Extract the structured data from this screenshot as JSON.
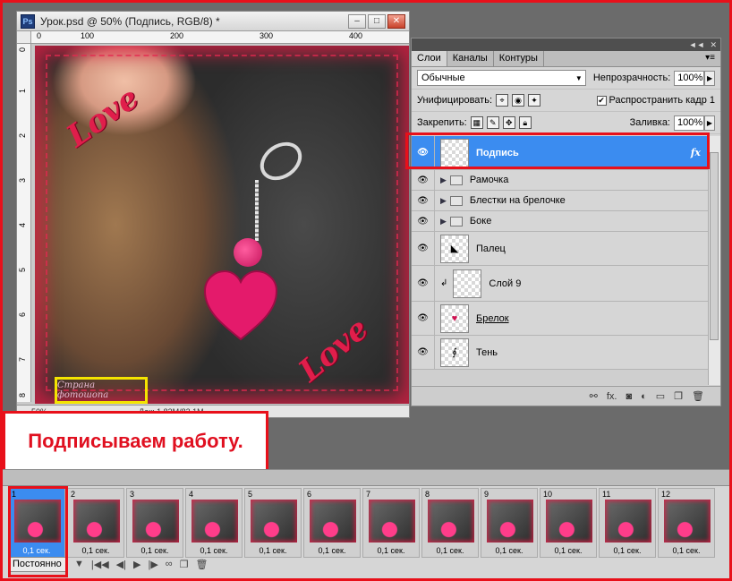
{
  "document": {
    "title": "Урок.psd @ 50% (Подпись, RGB/8) *",
    "zoom": "50%",
    "doc_info": "Док: 1,83M/82,1M",
    "ruler_marks": [
      "0",
      "100",
      "200",
      "300",
      "400"
    ],
    "ruler_v_marks": [
      "0",
      "1",
      "2",
      "3",
      "4",
      "5",
      "6",
      "7",
      "8"
    ],
    "artwork_text_1": "Love",
    "artwork_text_2": "Love",
    "signature": "Страна фотошопа"
  },
  "layers_panel": {
    "tabs": [
      "Слои",
      "Каналы",
      "Контуры"
    ],
    "blend_mode": "Обычные",
    "opacity_label": "Непрозрачность:",
    "opacity_value": "100%",
    "unify_label": "Унифицировать:",
    "propagate_label": "Распространить кадр 1",
    "lock_label": "Закрепить:",
    "fill_label": "Заливка:",
    "fill_value": "100%",
    "layers": [
      {
        "name": "Подпись",
        "selected": true,
        "type": "layer",
        "fx": "fx"
      },
      {
        "name": "Рамочка",
        "type": "group"
      },
      {
        "name": "Блестки на брелочке",
        "type": "group"
      },
      {
        "name": "Боке",
        "type": "group"
      },
      {
        "name": "Палец",
        "type": "layer"
      },
      {
        "name": "Слой 9",
        "type": "clipped"
      },
      {
        "name": "Брелок",
        "type": "layer"
      },
      {
        "name": "Тень",
        "type": "layer"
      }
    ]
  },
  "caption": "Подписываем работу.",
  "timeline": {
    "frames": [
      {
        "num": "1",
        "time": "0,1 сек."
      },
      {
        "num": "2",
        "time": "0,1 сек."
      },
      {
        "num": "3",
        "time": "0,1 сек."
      },
      {
        "num": "4",
        "time": "0,1 сек."
      },
      {
        "num": "5",
        "time": "0,1 сек."
      },
      {
        "num": "6",
        "time": "0,1 сек."
      },
      {
        "num": "7",
        "time": "0,1 сек."
      },
      {
        "num": "8",
        "time": "0,1 сек."
      },
      {
        "num": "9",
        "time": "0,1 сек."
      },
      {
        "num": "10",
        "time": "0,1 сек."
      },
      {
        "num": "11",
        "time": "0,1 сек."
      },
      {
        "num": "12",
        "time": "0,1 сек."
      }
    ],
    "loop": "Постоянно"
  }
}
